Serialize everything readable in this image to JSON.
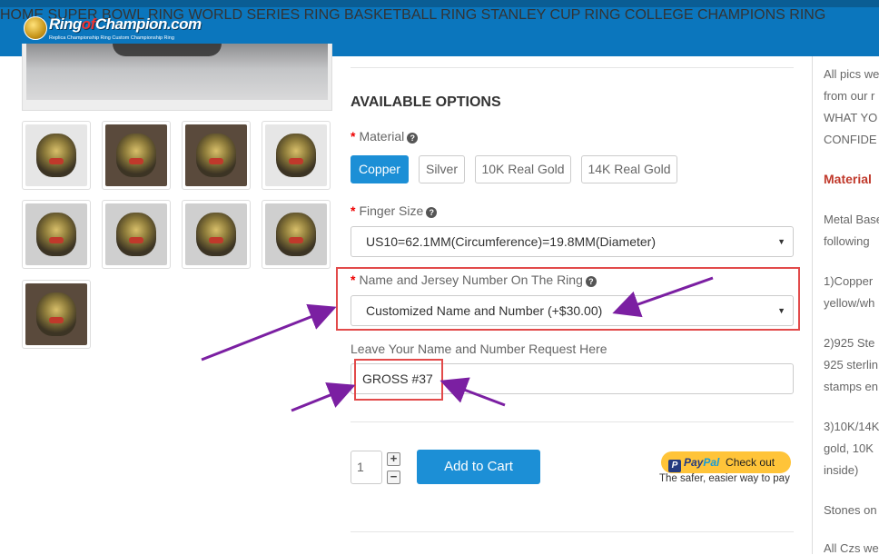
{
  "nav": {
    "logo": {
      "brand_a": "Ring",
      "brand_of": "of",
      "brand_b": "Champion.com",
      "tagline": "Replica Championship Ring Custom Championship Ring"
    },
    "items": [
      {
        "label": "HOME"
      },
      {
        "label": "SUPER BOWL RING"
      },
      {
        "label": "WORLD SERIES RING"
      },
      {
        "label": "BASKETBALL RING"
      },
      {
        "label": "STANLEY CUP RING"
      },
      {
        "label": "COLLEGE CHAMPIONS RING"
      }
    ]
  },
  "options": {
    "title": "AVAILABLE OPTIONS",
    "material": {
      "label": "Material",
      "required_mark": "*",
      "help_icon": "?",
      "choices": [
        "Copper",
        "Silver",
        "10K Real Gold",
        "14K Real Gold"
      ],
      "selected": "Copper"
    },
    "finger_size": {
      "label": "Finger Size",
      "required_mark": "*",
      "help_icon": "?",
      "value": "US10=62.1MM(Circumference)=19.8MM(Diameter)"
    },
    "name_jersey": {
      "label": "Name and Jersey Number On The Ring",
      "required_mark": "*",
      "help_icon": "?",
      "value": "Customized Name and Number (+$30.00)"
    },
    "request": {
      "label": "Leave Your Name and Number Request Here",
      "value": "GROSS #37"
    }
  },
  "cart": {
    "quantity": "1",
    "plus": "+",
    "minus": "−",
    "add_label": "Add to Cart"
  },
  "paypal": {
    "logo": "P",
    "word_pay": "Pay",
    "word_pal": "Pal",
    "checkout": "Check out",
    "tagline": "The safer, easier way to pay"
  },
  "sidebar": {
    "lines": [
      "All pics we",
      "from our r",
      "WHAT YO",
      "CONFIDE",
      "Metal Base",
      "following",
      "1)Copper",
      "yellow/wh",
      "2)925 Ste",
      "925 sterlin",
      "stamps en",
      "3)10K/14K",
      "gold, 10K",
      "inside)",
      "Stones on",
      "All Czs we"
    ],
    "heading": "Material"
  },
  "colors": {
    "nav_bg": "#0b76bd",
    "accent": "#1c8fd6",
    "annotation_box": "#e24a4a",
    "annotation_arrow": "#7b1fa2"
  }
}
